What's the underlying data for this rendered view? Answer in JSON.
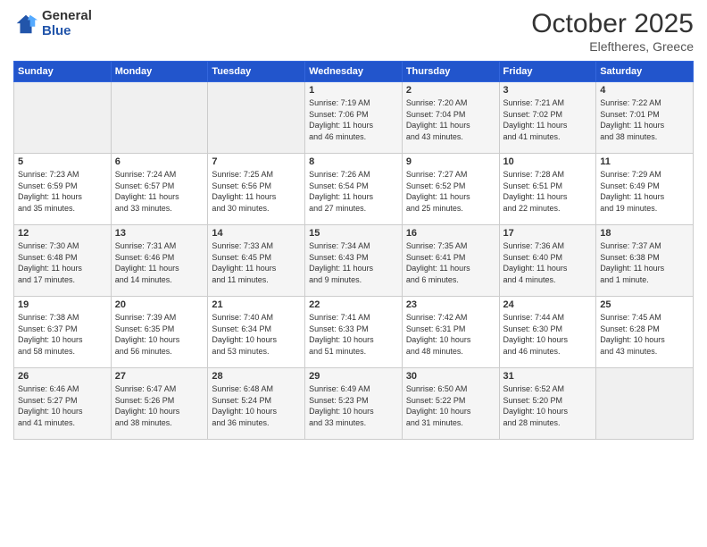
{
  "header": {
    "logo_general": "General",
    "logo_blue": "Blue",
    "title": "October 2025",
    "location": "Eleftheres, Greece"
  },
  "weekdays": [
    "Sunday",
    "Monday",
    "Tuesday",
    "Wednesday",
    "Thursday",
    "Friday",
    "Saturday"
  ],
  "weeks": [
    [
      {
        "day": "",
        "info": ""
      },
      {
        "day": "",
        "info": ""
      },
      {
        "day": "",
        "info": ""
      },
      {
        "day": "1",
        "info": "Sunrise: 7:19 AM\nSunset: 7:06 PM\nDaylight: 11 hours\nand 46 minutes."
      },
      {
        "day": "2",
        "info": "Sunrise: 7:20 AM\nSunset: 7:04 PM\nDaylight: 11 hours\nand 43 minutes."
      },
      {
        "day": "3",
        "info": "Sunrise: 7:21 AM\nSunset: 7:02 PM\nDaylight: 11 hours\nand 41 minutes."
      },
      {
        "day": "4",
        "info": "Sunrise: 7:22 AM\nSunset: 7:01 PM\nDaylight: 11 hours\nand 38 minutes."
      }
    ],
    [
      {
        "day": "5",
        "info": "Sunrise: 7:23 AM\nSunset: 6:59 PM\nDaylight: 11 hours\nand 35 minutes."
      },
      {
        "day": "6",
        "info": "Sunrise: 7:24 AM\nSunset: 6:57 PM\nDaylight: 11 hours\nand 33 minutes."
      },
      {
        "day": "7",
        "info": "Sunrise: 7:25 AM\nSunset: 6:56 PM\nDaylight: 11 hours\nand 30 minutes."
      },
      {
        "day": "8",
        "info": "Sunrise: 7:26 AM\nSunset: 6:54 PM\nDaylight: 11 hours\nand 27 minutes."
      },
      {
        "day": "9",
        "info": "Sunrise: 7:27 AM\nSunset: 6:52 PM\nDaylight: 11 hours\nand 25 minutes."
      },
      {
        "day": "10",
        "info": "Sunrise: 7:28 AM\nSunset: 6:51 PM\nDaylight: 11 hours\nand 22 minutes."
      },
      {
        "day": "11",
        "info": "Sunrise: 7:29 AM\nSunset: 6:49 PM\nDaylight: 11 hours\nand 19 minutes."
      }
    ],
    [
      {
        "day": "12",
        "info": "Sunrise: 7:30 AM\nSunset: 6:48 PM\nDaylight: 11 hours\nand 17 minutes."
      },
      {
        "day": "13",
        "info": "Sunrise: 7:31 AM\nSunset: 6:46 PM\nDaylight: 11 hours\nand 14 minutes."
      },
      {
        "day": "14",
        "info": "Sunrise: 7:33 AM\nSunset: 6:45 PM\nDaylight: 11 hours\nand 11 minutes."
      },
      {
        "day": "15",
        "info": "Sunrise: 7:34 AM\nSunset: 6:43 PM\nDaylight: 11 hours\nand 9 minutes."
      },
      {
        "day": "16",
        "info": "Sunrise: 7:35 AM\nSunset: 6:41 PM\nDaylight: 11 hours\nand 6 minutes."
      },
      {
        "day": "17",
        "info": "Sunrise: 7:36 AM\nSunset: 6:40 PM\nDaylight: 11 hours\nand 4 minutes."
      },
      {
        "day": "18",
        "info": "Sunrise: 7:37 AM\nSunset: 6:38 PM\nDaylight: 11 hours\nand 1 minute."
      }
    ],
    [
      {
        "day": "19",
        "info": "Sunrise: 7:38 AM\nSunset: 6:37 PM\nDaylight: 10 hours\nand 58 minutes."
      },
      {
        "day": "20",
        "info": "Sunrise: 7:39 AM\nSunset: 6:35 PM\nDaylight: 10 hours\nand 56 minutes."
      },
      {
        "day": "21",
        "info": "Sunrise: 7:40 AM\nSunset: 6:34 PM\nDaylight: 10 hours\nand 53 minutes."
      },
      {
        "day": "22",
        "info": "Sunrise: 7:41 AM\nSunset: 6:33 PM\nDaylight: 10 hours\nand 51 minutes."
      },
      {
        "day": "23",
        "info": "Sunrise: 7:42 AM\nSunset: 6:31 PM\nDaylight: 10 hours\nand 48 minutes."
      },
      {
        "day": "24",
        "info": "Sunrise: 7:44 AM\nSunset: 6:30 PM\nDaylight: 10 hours\nand 46 minutes."
      },
      {
        "day": "25",
        "info": "Sunrise: 7:45 AM\nSunset: 6:28 PM\nDaylight: 10 hours\nand 43 minutes."
      }
    ],
    [
      {
        "day": "26",
        "info": "Sunrise: 6:46 AM\nSunset: 5:27 PM\nDaylight: 10 hours\nand 41 minutes."
      },
      {
        "day": "27",
        "info": "Sunrise: 6:47 AM\nSunset: 5:26 PM\nDaylight: 10 hours\nand 38 minutes."
      },
      {
        "day": "28",
        "info": "Sunrise: 6:48 AM\nSunset: 5:24 PM\nDaylight: 10 hours\nand 36 minutes."
      },
      {
        "day": "29",
        "info": "Sunrise: 6:49 AM\nSunset: 5:23 PM\nDaylight: 10 hours\nand 33 minutes."
      },
      {
        "day": "30",
        "info": "Sunrise: 6:50 AM\nSunset: 5:22 PM\nDaylight: 10 hours\nand 31 minutes."
      },
      {
        "day": "31",
        "info": "Sunrise: 6:52 AM\nSunset: 5:20 PM\nDaylight: 10 hours\nand 28 minutes."
      },
      {
        "day": "",
        "info": ""
      }
    ]
  ]
}
